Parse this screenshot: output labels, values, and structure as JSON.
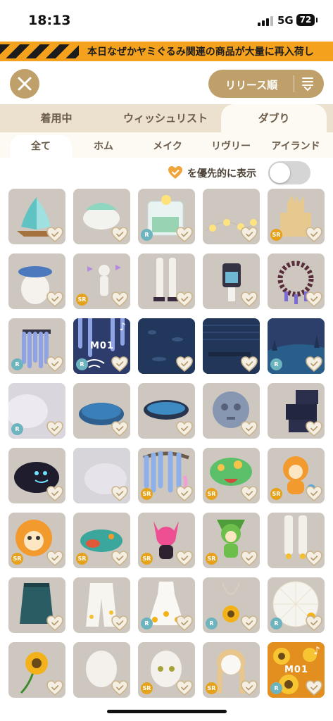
{
  "status": {
    "time": "18:13",
    "network": "5G",
    "battery": "72"
  },
  "banner": {
    "text": "本日なぜかヤミぐるみ関連の商品が大量に再入荷し"
  },
  "toolbar": {
    "sort_label": "リリース順"
  },
  "tabs": [
    "着用中",
    "ウィッシュリスト",
    "ダブり"
  ],
  "active_tab": 2,
  "subtabs": [
    "全て",
    "ホム",
    "メイク",
    "リヴリー",
    "アイランド"
  ],
  "active_subtab": 0,
  "filter": {
    "label": "を優先的に表示",
    "enabled": false
  },
  "colors": {
    "accent": "#bfa06a",
    "banner": "#f4a11e",
    "sr_badge": "#e5a21a",
    "r_badge": "#6eb4bf",
    "heart": "#f0a53a"
  },
  "grid": {
    "items": [
      {
        "name": "sailboat",
        "badge": ""
      },
      {
        "name": "shell",
        "badge": ""
      },
      {
        "name": "glass-cube",
        "badge": "R"
      },
      {
        "name": "string-lights",
        "badge": ""
      },
      {
        "name": "sandcastle",
        "badge": "SR"
      },
      {
        "name": "blue-flower-hat",
        "badge": ""
      },
      {
        "name": "butterfly-spirit",
        "badge": "SR"
      },
      {
        "name": "white-socks-sandals",
        "badge": ""
      },
      {
        "name": "dark-vest",
        "badge": ""
      },
      {
        "name": "bead-necklace",
        "badge": ""
      },
      {
        "name": "wisteria-hat",
        "badge": "R"
      },
      {
        "name": "m01-wisteria-music",
        "badge": "R",
        "music": "M01"
      },
      {
        "name": "night-water-bg",
        "badge": ""
      },
      {
        "name": "night-pier-bg",
        "badge": ""
      },
      {
        "name": "forest-lake-bg",
        "badge": "R"
      },
      {
        "name": "mist",
        "badge": "R"
      },
      {
        "name": "blue-pond",
        "badge": ""
      },
      {
        "name": "pond-bowl",
        "badge": ""
      },
      {
        "name": "stone-face",
        "badge": ""
      },
      {
        "name": "dark-boxes",
        "badge": ""
      },
      {
        "name": "shadow-creature",
        "badge": ""
      },
      {
        "name": "fog-cloud",
        "badge": ""
      },
      {
        "name": "wisteria-tree",
        "badge": "SR"
      },
      {
        "name": "green-frog-mushroom",
        "badge": "SR"
      },
      {
        "name": "orange-fox-doll",
        "badge": "SR"
      },
      {
        "name": "orange-bear-mask",
        "badge": "SR"
      },
      {
        "name": "teal-fish-plush",
        "badge": "SR"
      },
      {
        "name": "pink-cat-doll",
        "badge": "SR"
      },
      {
        "name": "green-bird-doll",
        "badge": "SR"
      },
      {
        "name": "flower-socks",
        "badge": ""
      },
      {
        "name": "teal-skirt",
        "badge": ""
      },
      {
        "name": "white-flower-pants",
        "badge": ""
      },
      {
        "name": "white-sunflower-dress",
        "badge": "R"
      },
      {
        "name": "sunflower-bag",
        "badge": "R"
      },
      {
        "name": "sunflower-umbrella",
        "badge": "R"
      },
      {
        "name": "sunflower",
        "badge": ""
      },
      {
        "name": "blank-head",
        "badge": ""
      },
      {
        "name": "face-eyes",
        "badge": "SR"
      },
      {
        "name": "braided-hair",
        "badge": "SR"
      },
      {
        "name": "m01-sunflower-music",
        "badge": "R",
        "music": "M01"
      }
    ]
  }
}
